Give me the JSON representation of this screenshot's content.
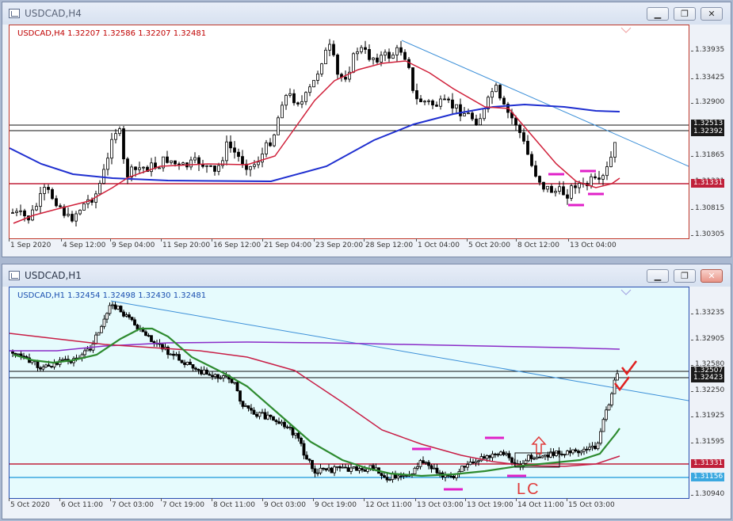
{
  "top_window": {
    "title": "USDCAD,H4",
    "chart_label": "USDCAD,H4  1.32207 1.32586 1.32207 1.32481",
    "price_ticks": [
      "1.33935",
      "1.33425",
      "1.32900",
      "1.32380",
      "1.31865",
      "1.31331",
      "1.30815",
      "1.30305"
    ],
    "price_boxes": [
      "1.32513",
      "1.32392",
      "1.31331"
    ],
    "time_ticks": [
      "1 Sep 2020",
      "4 Sep 12:00",
      "9 Sep 04:00",
      "11 Sep 20:00",
      "16 Sep 12:00",
      "21 Sep 04:00",
      "23 Sep 20:00",
      "28 Sep 12:00",
      "1 Oct 04:00",
      "5 Oct 20:00",
      "8 Oct 12:00",
      "13 Oct 04:00"
    ],
    "colors": {
      "chart_bg": "#ffffff",
      "label": "#c00000",
      "blue_ma": "#1f2fd0",
      "red_ma": "#d0203a",
      "trendline": "#3b8fd8",
      "support": "#c0203a",
      "marker": "#e020c8"
    }
  },
  "bottom_window": {
    "title": "USDCAD,H1",
    "chart_label": "USDCAD,H1  1.32454 1.32498 1.32430 1.32481",
    "price_ticks": [
      "1.33235",
      "1.32905",
      "1.32580",
      "1.32250",
      "1.31925",
      "1.31595",
      "1.31270",
      "1.30940"
    ],
    "price_boxes": [
      "1.32507",
      "1.32423",
      "1.31331",
      "1.31156"
    ],
    "time_ticks": [
      "5 Oct 2020",
      "6 Oct 11:00",
      "7 Oct 03:00",
      "7 Oct 19:00",
      "8 Oct 11:00",
      "9 Oct 03:00",
      "9 Oct 19:00",
      "12 Oct 11:00",
      "13 Oct 03:00",
      "13 Oct 19:00",
      "14 Oct 11:00",
      "15 Oct 03:00"
    ],
    "annotation_text": "LC",
    "colors": {
      "chart_bg": "#e6fbfd",
      "label": "#1a4fb0",
      "purple_ma": "#8a2bc8",
      "red_ma": "#c81e46",
      "green_ma": "#2e8b30",
      "trendline": "#3b8fd8",
      "support": "#c0203a",
      "support2": "#3ba8e0",
      "marker": "#e020c8",
      "annotation": "#e03a3a"
    }
  },
  "icons": [
    "chart-window-icon",
    "minimize-icon",
    "restore-icon",
    "close-icon"
  ]
}
